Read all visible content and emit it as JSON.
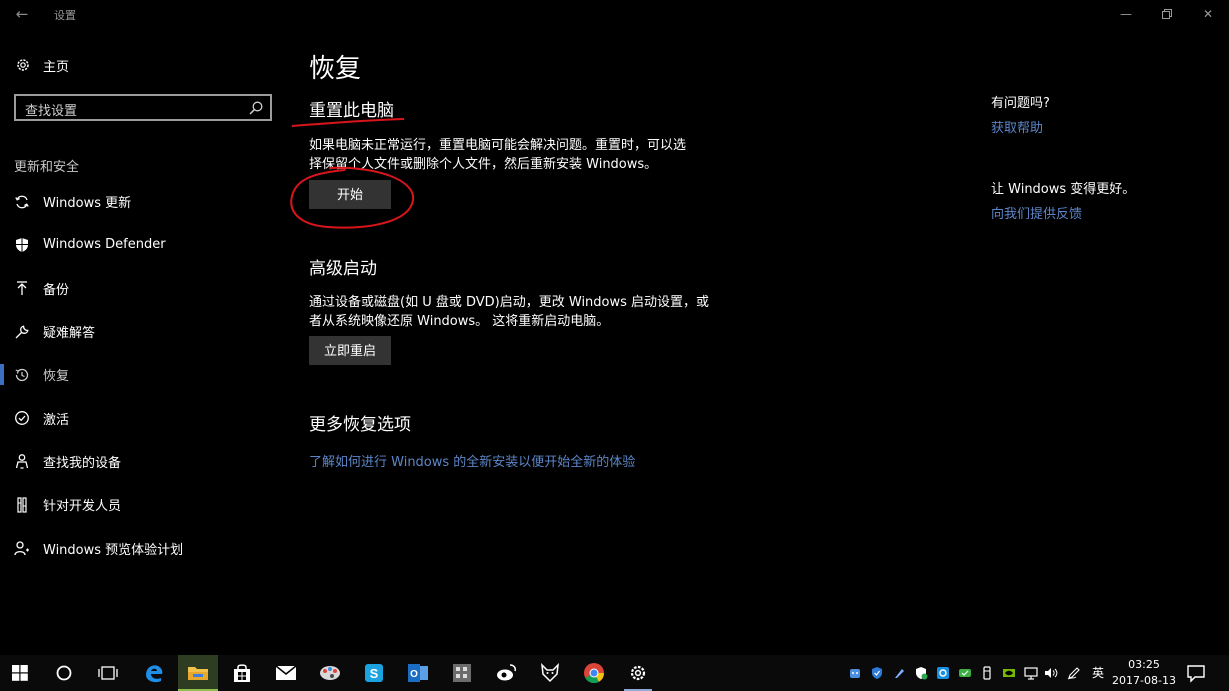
{
  "window": {
    "title": "设置",
    "back_icon": "back-arrow-icon",
    "controls": [
      "minimize-icon",
      "maximize-icon",
      "close-icon"
    ]
  },
  "sidebar": {
    "home": {
      "label": "主页",
      "icon": "gear-icon"
    },
    "search": {
      "placeholder": "查找设置",
      "icon": "search-icon"
    },
    "section_title": "更新和安全",
    "items": [
      {
        "label": "Windows 更新",
        "icon": "sync-icon"
      },
      {
        "label": "Windows Defender",
        "icon": "shield-icon"
      },
      {
        "label": "备份",
        "icon": "upload-arrow-icon"
      },
      {
        "label": "疑难解答",
        "icon": "wrench-icon"
      },
      {
        "label": "恢复",
        "icon": "history-icon",
        "active": true
      },
      {
        "label": "激活",
        "icon": "check-circle-icon"
      },
      {
        "label": "查找我的设备",
        "icon": "person-location-icon"
      },
      {
        "label": "针对开发人员",
        "icon": "developer-tools-icon"
      },
      {
        "label": "Windows 预览体验计划",
        "icon": "insider-person-icon"
      }
    ],
    "accent_color": "#3a6fc2"
  },
  "main": {
    "title": "恢复",
    "reset": {
      "heading": "重置此电脑",
      "desc_line1": "如果电脑未正常运行，重置电脑可能会解决问题。重置时，可以选",
      "desc_line2": "择保留个人文件或删除个人文件，然后重新安装 Windows。",
      "button": "开始"
    },
    "advanced": {
      "heading": "高级启动",
      "desc_line1": "通过设备或磁盘(如 U 盘或 DVD)启动，更改 Windows 启动设置，或",
      "desc_line2": "者从系统映像还原 Windows。 这将重新启动电脑。",
      "button": "立即重启"
    },
    "more": {
      "heading": "更多恢复选项",
      "link": "了解如何进行 Windows 的全新安装以便开始全新的体验"
    }
  },
  "right": {
    "help_title": "有问题吗?",
    "help_link": "获取帮助",
    "feedback_title": "让 Windows 变得更好。",
    "feedback_link": "向我们提供反馈",
    "link_color": "#5c86c8"
  },
  "annotations": {
    "color": "#d8151b",
    "marks": [
      "underline-under-reset-heading",
      "circle-around-start-button"
    ]
  },
  "taskbar": {
    "apps": [
      "start-windows-icon",
      "cortana-circle-icon",
      "task-view-icon",
      "edge-icon",
      "file-explorer-icon",
      "store-icon",
      "mail-icon",
      "paint-palette-app-icon",
      "skype-icon",
      "outlook-icon",
      "calculator-app-icon",
      "weibo-icon",
      "fox-app-icon",
      "chrome-icon",
      "settings-gear-icon"
    ],
    "active_app": "file-explorer-icon",
    "running_app": "settings-gear-icon",
    "tray_icons": [
      "tray-app-icon",
      "tray-shield-icon",
      "tray-feather-icon",
      "tray-defender-icon",
      "tray-blue-app-icon",
      "tray-green-app-icon",
      "tray-usb-icon",
      "tray-nvidia-icon",
      "tray-network-icon",
      "tray-volume-icon",
      "tray-pen-icon"
    ],
    "ime": "英",
    "time": "03:25",
    "date": "2017-08-13",
    "notification_icon": "action-center-icon"
  }
}
